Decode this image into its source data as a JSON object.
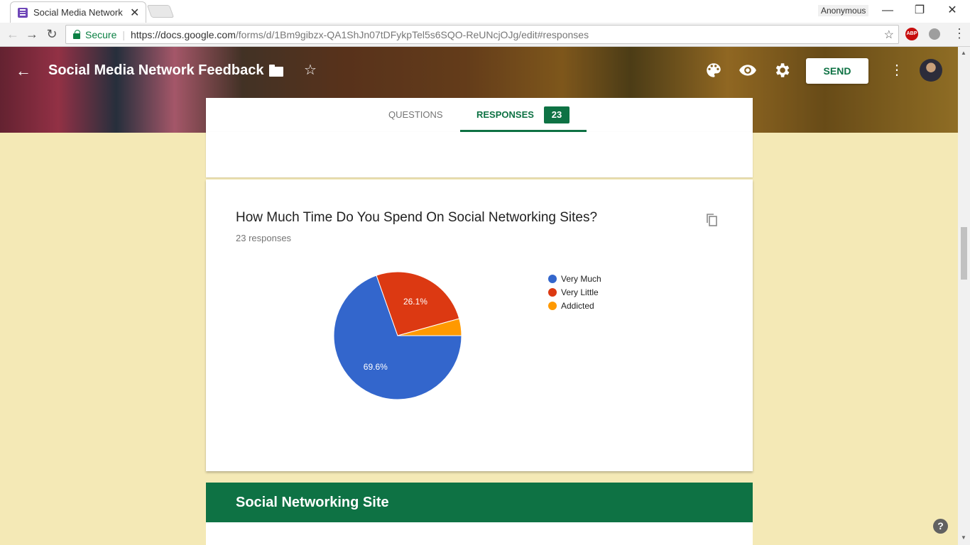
{
  "browser": {
    "tab_title": "Social Media Network Fe",
    "profile": "Anonymous",
    "secure_label": "Secure",
    "url_host": "https://docs.google.com",
    "url_path": "/forms/d/1Bm9gibzx-QA1ShJn07tDFykpTel5s6SQO-ReUNcjOJg/edit#responses",
    "ext_abp": "ABP"
  },
  "header": {
    "form_title": "Social Media Network Feedback",
    "send_label": "SEND"
  },
  "tabs": {
    "questions": "QUESTIONS",
    "responses": "RESPONSES",
    "responses_count": "23"
  },
  "question": {
    "title": "How Much Time Do You Spend On Social Networking Sites?",
    "count": "23 responses"
  },
  "chart_data": {
    "type": "pie",
    "categories": [
      "Very Much",
      "Very Little",
      "Addicted"
    ],
    "values": [
      69.6,
      26.1,
      4.3
    ],
    "labels": [
      "69.6%",
      "26.1%",
      ""
    ],
    "colors": [
      "#3366cc",
      "#dc3912",
      "#ff9900"
    ],
    "legend": "right"
  },
  "section": {
    "title": "Social Networking Site"
  },
  "help_label": "?"
}
